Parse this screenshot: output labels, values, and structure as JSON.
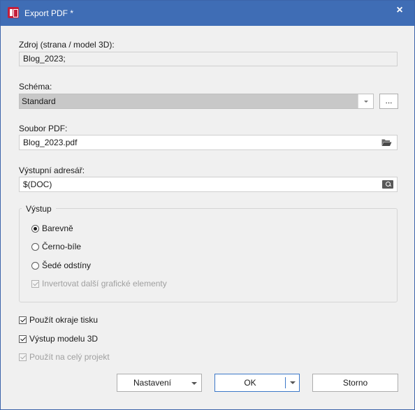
{
  "window": {
    "title": "Export PDF *",
    "close_glyph": "×"
  },
  "source": {
    "label": "Zdroj (strana / model 3D):",
    "value": "Blog_2023;"
  },
  "scheme": {
    "label": "Schéma:",
    "selected": "Standard",
    "browse_label": "..."
  },
  "pdf_file": {
    "label": "Soubor PDF:",
    "value": "Blog_2023.pdf",
    "icon": "folder-open-icon"
  },
  "output_dir": {
    "label": "Výstupní adresář:",
    "value": "$(DOC)",
    "icon": "search-icon"
  },
  "output_group": {
    "legend": "Výstup",
    "options": [
      {
        "label": "Barevně",
        "checked": true
      },
      {
        "label": "Černo-bíle",
        "checked": false
      },
      {
        "label": "Šedé odstíny",
        "checked": false
      }
    ],
    "invert_label": "Invertovat další grafické elementy",
    "invert_checked": true,
    "invert_enabled": false
  },
  "options": [
    {
      "label": "Použít okraje tisku",
      "checked": true,
      "enabled": true
    },
    {
      "label": "Výstup modelu 3D",
      "checked": true,
      "enabled": true
    },
    {
      "label": "Použít na celý projekt",
      "checked": true,
      "enabled": false
    }
  ],
  "buttons": {
    "settings": "Nastavení",
    "ok": "OK",
    "cancel": "Storno"
  },
  "colors": {
    "titlebar": "#3f6db5",
    "app_icon": "#c41e3a",
    "primary_border": "#3c78c8"
  }
}
